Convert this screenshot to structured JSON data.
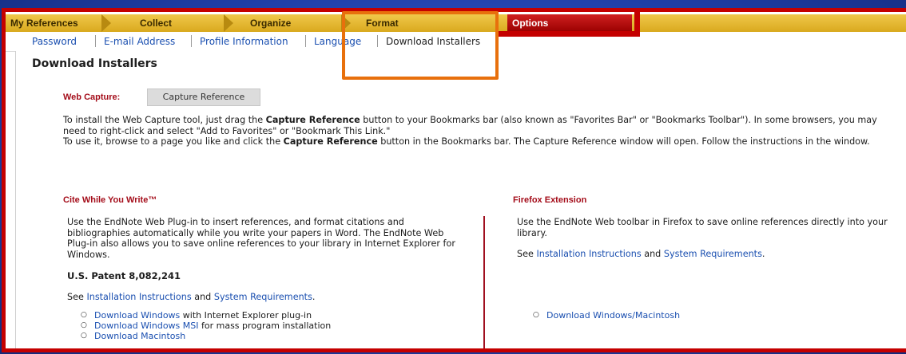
{
  "tabs": [
    "My References",
    "Collect",
    "Organize",
    "Format",
    "Options"
  ],
  "subnav": [
    "Password",
    "E-mail Address",
    "Profile Information",
    "Language",
    "Download Installers"
  ],
  "page_title": "Download Installers",
  "web_capture": {
    "label": "Web Capture:",
    "button": "Capture Reference",
    "p1_a": "To install the Web Capture tool, just drag the ",
    "p1_b": "Capture Reference",
    "p1_c": " button to your Bookmarks bar (also known as \"Favorites Bar\" or \"Bookmarks Toolbar\"). In some browsers, you may need to right-click and select \"Add to Favorites\" or \"Bookmark This Link.\"",
    "p2_a": "To use it, browse to a page you like and click the ",
    "p2_b": "Capture Reference",
    "p2_c": " button in the Bookmarks bar. The Capture Reference window will open. Follow the instructions in the window."
  },
  "cwyw": {
    "heading": "Cite While You Write™",
    "desc": "Use the EndNote Web Plug-in to insert references, and format citations and bibliographies automatically while you write your papers in Word. The EndNote Web Plug-in also allows you to save online references to your library in Internet Explorer for Windows.",
    "patent": "U.S. Patent 8,082,241",
    "see": "See ",
    "install_link": "Installation Instructions",
    "and": " and ",
    "req_link": "System Requirements",
    "period": ".",
    "downloads": [
      {
        "link": "Download Windows",
        "rest": " with Internet Explorer plug-in"
      },
      {
        "link": "Download Windows MSI",
        "rest": " for mass program installation"
      },
      {
        "link": "Download Macintosh",
        "rest": ""
      }
    ]
  },
  "firefox": {
    "heading": "Firefox Extension",
    "desc": "Use the EndNote Web toolbar in Firefox to save online references directly into your library.",
    "see": "See ",
    "install_link": "Installation Instructions",
    "and": " and ",
    "req_link": "System Requirements",
    "period": ".",
    "download": "Download Windows/Macintosh"
  },
  "colors": {
    "tab_bar": "#d9a91e",
    "options_tab": "#b00000",
    "link": "#1a4fb0",
    "heading_red": "#a40d1a",
    "highlight_orange": "#e8700c",
    "highlight_red": "#c40000"
  }
}
